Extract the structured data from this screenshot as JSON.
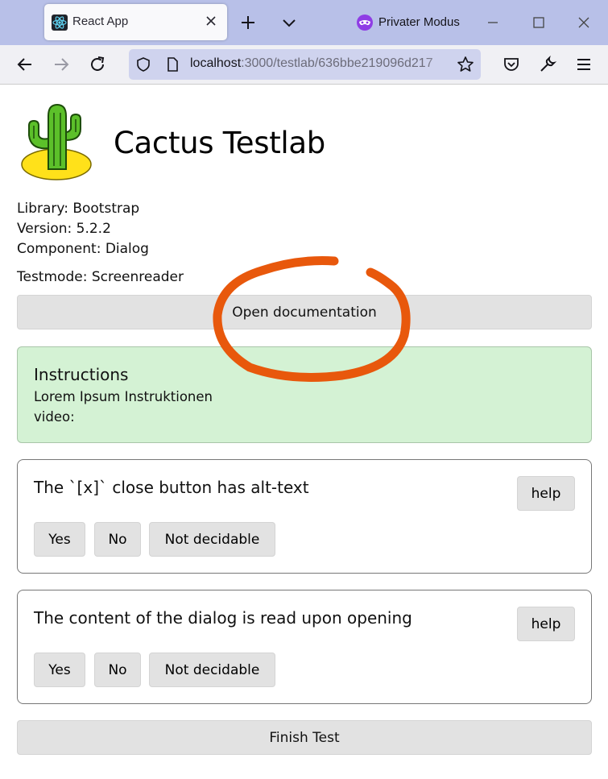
{
  "browser": {
    "tab_title": "React App",
    "private_mode_label": "Privater Modus",
    "url_host": "localhost",
    "url_path": ":3000/testlab/636bbe219096d217",
    "accent_color": "#b8c0e8"
  },
  "app": {
    "title": "Cactus Testlab",
    "library": "Library: Bootstrap",
    "version": "Version: 5.2.2",
    "component": "Component: Dialog",
    "testmode": "Testmode: Screenreader",
    "open_docs_label": "Open documentation",
    "instructions": {
      "title": "Instructions",
      "line1": "Lorem Ipsum Instruktionen",
      "line2": "video:"
    },
    "questions": [
      {
        "text": "The `[x]` close button has alt-text",
        "help_label": "help",
        "answers": [
          "Yes",
          "No",
          "Not decidable"
        ]
      },
      {
        "text": "The content of the dialog is read upon opening",
        "help_label": "help",
        "answers": [
          "Yes",
          "No",
          "Not decidable"
        ]
      }
    ],
    "finish_label": "Finish Test"
  },
  "colors": {
    "instructions_bg": "#d4f2d4",
    "button_bg": "#e2e2e2",
    "annotation": "#e8580c"
  }
}
